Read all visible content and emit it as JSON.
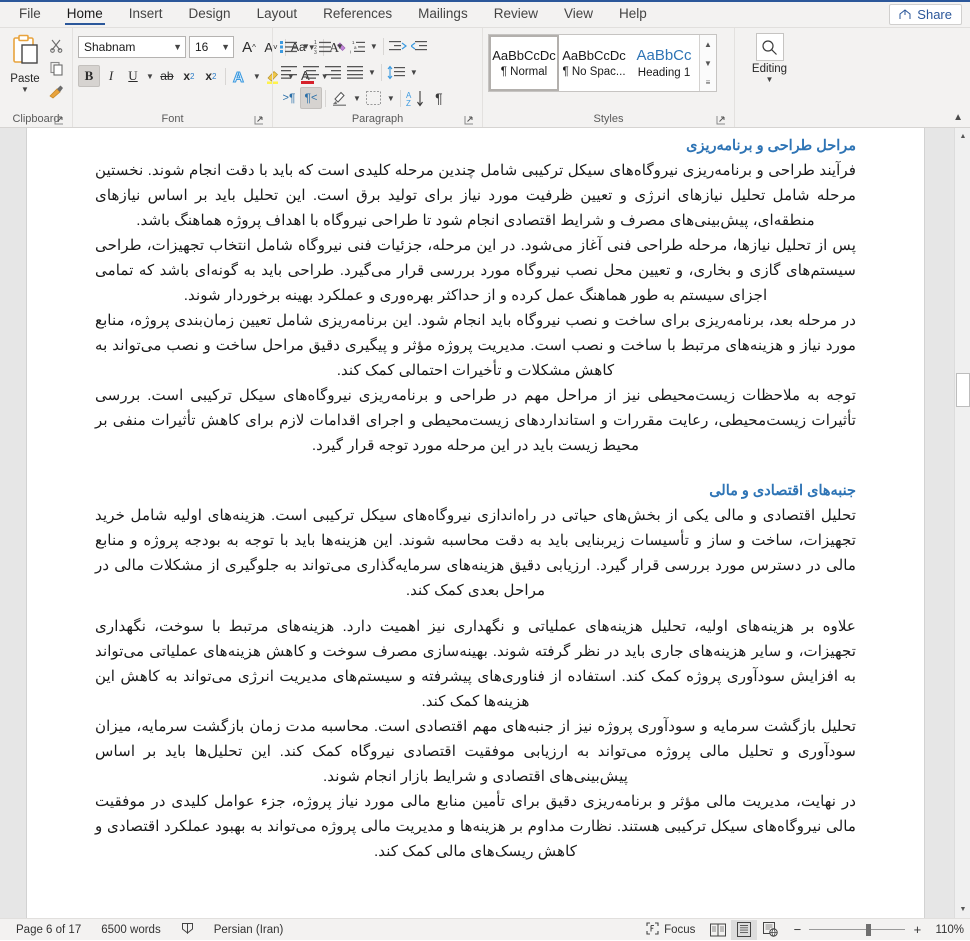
{
  "app": {
    "tabs": [
      {
        "label": "File",
        "active": false
      },
      {
        "label": "Home",
        "active": true
      },
      {
        "label": "Insert",
        "active": false
      },
      {
        "label": "Design",
        "active": false
      },
      {
        "label": "Layout",
        "active": false
      },
      {
        "label": "References",
        "active": false
      },
      {
        "label": "Mailings",
        "active": false
      },
      {
        "label": "Review",
        "active": false
      },
      {
        "label": "View",
        "active": false
      },
      {
        "label": "Help",
        "active": false
      }
    ],
    "share_label": "Share",
    "accent_color": "#2b579a",
    "heading_color": "#2e74b5"
  },
  "ribbon": {
    "clipboard": {
      "group_label": "Clipboard",
      "paste_label": "Paste",
      "cut_icon": "scissors-icon",
      "copy_icon": "copy-icon",
      "format_painter_icon": "format-painter-icon"
    },
    "font": {
      "group_label": "Font",
      "font_name": "Shabnam",
      "font_size": "16",
      "grow_font_label": "A",
      "shrink_font_label": "A",
      "change_case_label": "Aa",
      "clear_formatting_label": "A",
      "bold_label": "B",
      "italic_label": "I",
      "underline_label": "U",
      "strikethrough_label": "ab",
      "subscript_label": "x",
      "superscript_label": "x",
      "text_effects_label": "A",
      "highlight_label": "",
      "font_color_label": "A"
    },
    "paragraph": {
      "group_label": "Paragraph",
      "bullets": "bullets-icon",
      "numbering": "numbering-icon",
      "multilevel": "multilevel-list-icon",
      "decrease_indent": "decrease-indent-icon",
      "increase_indent": "increase-indent-icon",
      "align_left": "align-left-icon",
      "align_center": "align-center-icon",
      "align_right": "align-right-icon",
      "justify": "justify-icon",
      "line_spacing": "line-spacing-icon",
      "ltr_label": "¶",
      "rtl_label": "¶",
      "shading": "shading-icon",
      "borders": "borders-icon",
      "sort_label": "A\nZ",
      "show_marks_label": "¶"
    },
    "styles": {
      "group_label": "Styles",
      "items": [
        {
          "preview": "AaBbCcDc",
          "name": "¶ Normal",
          "selected": true
        },
        {
          "preview": "AaBbCcDc",
          "name": "¶ No Spac...",
          "selected": false
        },
        {
          "preview": "AaBbCc",
          "name": "Heading 1",
          "selected": false
        }
      ]
    },
    "editing": {
      "group_label": "",
      "label": "Editing",
      "icon": "search-icon"
    }
  },
  "document": {
    "sections": [
      {
        "heading": "مراحل طراحی و برنامه‌ریزی",
        "paragraphs": [
          "فرآیند طراحی و برنامه‌ریزی نیروگاه‌های سیکل ترکیبی شامل چندین مرحله کلیدی است که باید با دقت انجام شوند. نخستین مرحله شامل تحلیل نیازهای انرژی و تعیین ظرفیت مورد نیاز برای تولید برق است. این تحلیل باید بر اساس نیازهای منطقه‌ای، پیش‌بینی‌های مصرف و شرایط اقتصادی انجام شود تا طراحی نیروگاه با اهداف پروژه هماهنگ باشد.",
          "پس از تحلیل نیازها، مرحله طراحی فنی آغاز می‌شود. در این مرحله، جزئیات فنی نیروگاه شامل انتخاب تجهیزات، طراحی سیستم‌های گازی و بخاری، و تعیین محل نصب نیروگاه مورد بررسی قرار می‌گیرد. طراحی باید به گونه‌ای باشد که تمامی اجزای سیستم به طور هماهنگ عمل کرده و از حداکثر بهره‌وری و عملکرد بهینه برخوردار شوند.",
          "در مرحله بعد، برنامه‌ریزی برای ساخت و نصب نیروگاه باید انجام شود. این برنامه‌ریزی شامل تعیین زمان‌بندی پروژه، منابع مورد نیاز و هزینه‌های مرتبط با ساخت و نصب است. مدیریت پروژه مؤثر و پیگیری دقیق مراحل ساخت و نصب می‌تواند به کاهش مشکلات و تأخیرات احتمالی کمک کند.",
          "توجه به ملاحظات زیست‌محیطی نیز از مراحل مهم در طراحی و برنامه‌ریزی نیروگاه‌های سیکل ترکیبی است. بررسی تأثیرات زیست‌محیطی، رعایت مقررات و استانداردهای زیست‌محیطی و اجرای اقدامات لازم برای کاهش تأثیرات منفی بر محیط زیست باید در این مرحله مورد توجه قرار گیرد."
        ]
      },
      {
        "heading": "جنبه‌های اقتصادی و مالی",
        "paragraphs": [
          "تحلیل اقتصادی و مالی یکی از بخش‌های حیاتی در راه‌اندازی نیروگاه‌های سیکل ترکیبی است. هزینه‌های اولیه شامل خرید تجهیزات، ساخت و ساز و تأسیسات زیربنایی باید به دقت محاسبه شوند. این هزینه‌ها باید با توجه به بودجه پروژه و منابع مالی در دسترس مورد بررسی قرار گیرد. ارزیابی دقیق هزینه‌های سرمایه‌گذاری می‌تواند به جلوگیری از مشکلات مالی در مراحل بعدی کمک کند.",
          "علاوه بر هزینه‌های اولیه، تحلیل هزینه‌های عملیاتی و نگهداری نیز اهمیت دارد. هزینه‌های مرتبط با سوخت، نگهداری تجهیزات، و سایر هزینه‌های جاری باید در نظر گرفته شوند. بهینه‌سازی مصرف سوخت و کاهش هزینه‌های عملیاتی می‌تواند به افزایش سودآوری پروژه کمک کند. استفاده از فناوری‌های پیشرفته و سیستم‌های مدیریت انرژی می‌تواند به کاهش این هزینه‌ها کمک کند.",
          "تحلیل بازگشت سرمایه و سودآوری پروژه نیز از جنبه‌های مهم اقتصادی است. محاسبه مدت زمان بازگشت سرمایه، میزان سودآوری و تحلیل مالی پروژه می‌تواند به ارزیابی موفقیت اقتصادی نیروگاه کمک کند. این تحلیل‌ها باید بر اساس پیش‌بینی‌های اقتصادی و شرایط بازار انجام شوند.",
          "در نهایت، مدیریت مالی مؤثر و برنامه‌ریزی دقیق برای تأمین منابع مالی مورد نیاز پروژه، جزء عوامل کلیدی در موفقیت مالی نیروگاه‌های سیکل ترکیبی هستند. نظارت مداوم بر هزینه‌ها و مدیریت مالی پروژه می‌تواند به بهبود عملکرد اقتصادی و کاهش ریسک‌های مالی کمک کند."
        ]
      }
    ]
  },
  "status": {
    "page": "Page 6 of 17",
    "words": "6500 words",
    "proofing_icon": "proofing-icon",
    "language": "Persian (Iran)",
    "focus_label": "Focus",
    "view_read_icon": "read-mode-icon",
    "view_print_icon": "print-layout-icon",
    "view_web_icon": "web-layout-icon",
    "zoom_out_label": "−",
    "zoom_in_label": "+",
    "zoom_level": "110%"
  }
}
